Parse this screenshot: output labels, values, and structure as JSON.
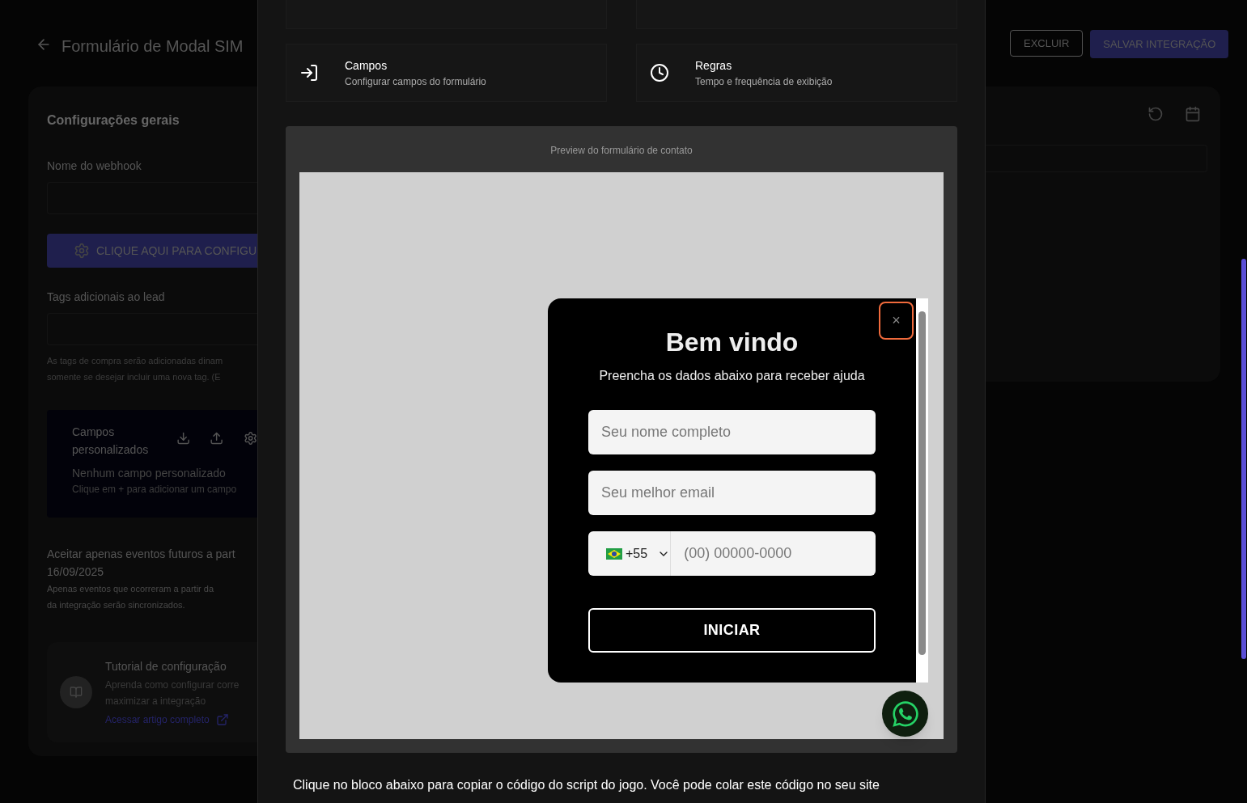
{
  "header": {
    "title": "Formulário de Modal SIM",
    "buttons": [
      {
        "label": "EXCLUIR",
        "kind": "outline"
      },
      {
        "label": "SALVAR INTEGRAÇÃO",
        "kind": "filled"
      }
    ]
  },
  "general": {
    "title": "Configurações gerais",
    "webhook_label": "Nome do webhook",
    "config_button": "CLIQUE AQUI PARA CONFIGU",
    "tags_label": "Tags adicionais ao lead",
    "tags_help": [
      "As tags de compra serão adicionadas dinam",
      "somente se desejar incluir uma nova tag. (E"
    ],
    "custom_fields": {
      "title": "Campos personalizados",
      "empty": "Nenhum campo personalizado",
      "hint": "Clique em + para adicionar um campo"
    },
    "future_events": {
      "label": "Aceitar apenas eventos futuros a part",
      "date": "16/09/2025",
      "help": [
        "Apenas eventos que ocorreram a partir da",
        "da integração serão sincronizados."
      ]
    },
    "tutorial": {
      "title": "Tutorial de configuração",
      "description": [
        "Aprenda como configurar corre",
        "maximizar a integração"
      ],
      "link": "Acessar artigo completo"
    }
  },
  "dialog": {
    "sections": [
      {
        "kind": "fields",
        "title": "Campos",
        "subtitle": "Configurar campos do formulário"
      },
      {
        "kind": "rules",
        "title": "Regras",
        "subtitle": "Tempo e frequência de exibição"
      }
    ],
    "preview": {
      "caption": "Preview do formulário de contato",
      "modal": {
        "close": "×",
        "title": "Bem vindo",
        "subtitle": "Preencha os dados abaixo para receber ajuda",
        "name_placeholder": "Seu nome completo",
        "email_placeholder": "Seu melhor email",
        "country_code": "+55",
        "phone_placeholder": "(00) 00000-0000",
        "submit": "INICIAR"
      }
    },
    "footer_text": "Clique no bloco abaixo para copiar o código do script do jogo. Você pode colar este código no seu site"
  }
}
